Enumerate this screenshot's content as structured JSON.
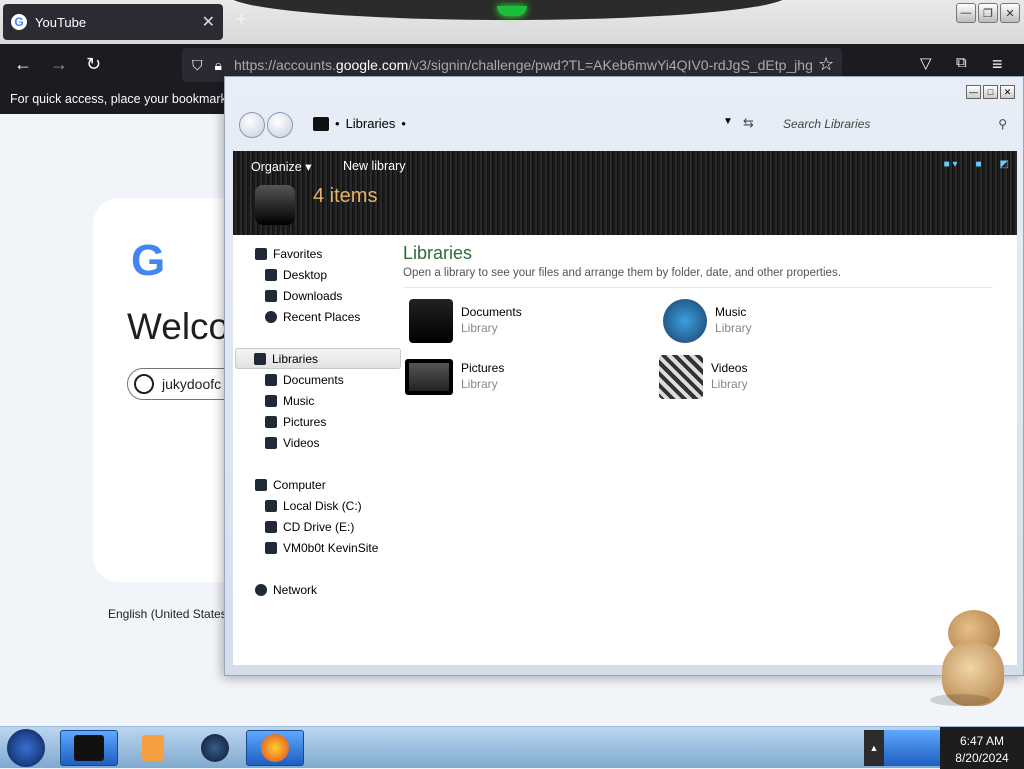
{
  "browser": {
    "tab_title": "YouTube",
    "url_prefix": "https://accounts.",
    "url_domain": "google.com",
    "url_suffix": "/v3/signin/challenge/pwd?TL=AKeb6mwYi4QIV0-rdJgS_dEtp_jhg",
    "bookmarks_hint": "For quick access, place your bookmarks here on the bookmarks toolbar."
  },
  "google": {
    "welcome": "Welcome",
    "account_text": "jukydoofc",
    "language": "English (United States)"
  },
  "explorer": {
    "breadcrumb": "Libraries",
    "search_placeholder": "Search Libraries",
    "toolbar": {
      "organize": "Organize",
      "new_library": "New library"
    },
    "item_count": "4 items",
    "content_title": "Libraries",
    "content_desc": "Open a library to see your files and arrange them by folder, date, and other properties.",
    "nav": {
      "favorites": "Favorites",
      "desktop": "Desktop",
      "downloads": "Downloads",
      "recent": "Recent Places",
      "libraries": "Libraries",
      "documents": "Documents",
      "music": "Music",
      "pictures": "Pictures",
      "videos": "Videos",
      "computer": "Computer",
      "local_disk": "Local Disk (C:)",
      "cd_drive": "CD Drive (E:)",
      "vm": "VM0b0t KevinSite",
      "network": "Network"
    },
    "libraries": [
      {
        "name": "Documents",
        "type": "Library"
      },
      {
        "name": "Music",
        "type": "Library"
      },
      {
        "name": "Pictures",
        "type": "Library"
      },
      {
        "name": "Videos",
        "type": "Library"
      }
    ]
  },
  "taskbar": {
    "time": "6:47 AM",
    "date": "8/20/2024"
  },
  "colors": {
    "library_title": "#2e6b3a",
    "item_count": "#e8b26a",
    "taskbar": "#7fa9d0"
  }
}
